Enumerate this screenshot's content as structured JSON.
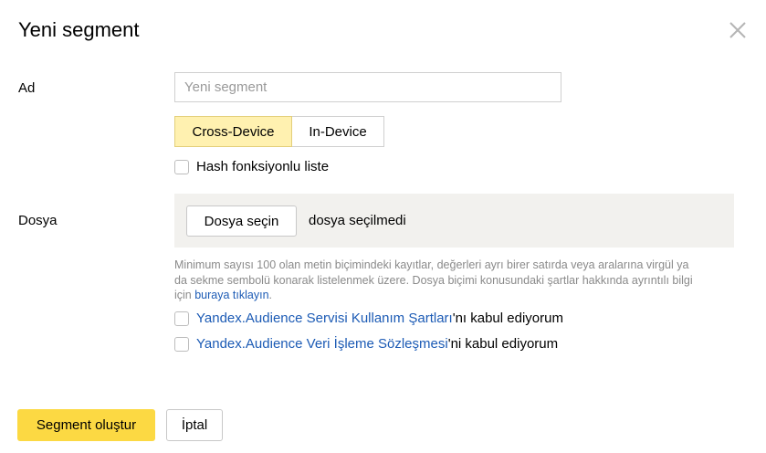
{
  "dialog": {
    "title": "Yeni segment",
    "close_icon": "close-icon"
  },
  "name_field": {
    "label": "Ad",
    "placeholder": "Yeni segment",
    "value": ""
  },
  "device_toggle": {
    "options": [
      "Cross-Device",
      "In-Device"
    ],
    "selected": "Cross-Device",
    "active_color": "#fff1b0"
  },
  "hash_checkbox": {
    "label": "Hash fonksiyonlu liste",
    "checked": false
  },
  "file_field": {
    "label": "Dosya",
    "button_label": "Dosya seçin",
    "status": "dosya seçilmedi"
  },
  "hint": {
    "text": "Minimum sayısı 100 olan metin biçimindeki kayıtlar, değerleri ayrı birer satırda veya aralarına virgül ya da sekme sembolü konarak listelenmek üzere. Dosya biçimi konusundaki şartlar hakkında ayrıntılı bilgi için ",
    "link": "buraya tıklayın",
    "suffix": "."
  },
  "terms": [
    {
      "link": "Yandex.Audience Servisi Kullanım Şartları",
      "suffix": "'nı kabul ediyorum",
      "checked": false
    },
    {
      "link": "Yandex.Audience Veri İşleme Sözleşmesi",
      "suffix": "'ni kabul ediyorum",
      "checked": false
    }
  ],
  "actions": {
    "create_label": "Segment oluştur",
    "cancel_label": "İptal",
    "primary_color": "#fcd943"
  }
}
